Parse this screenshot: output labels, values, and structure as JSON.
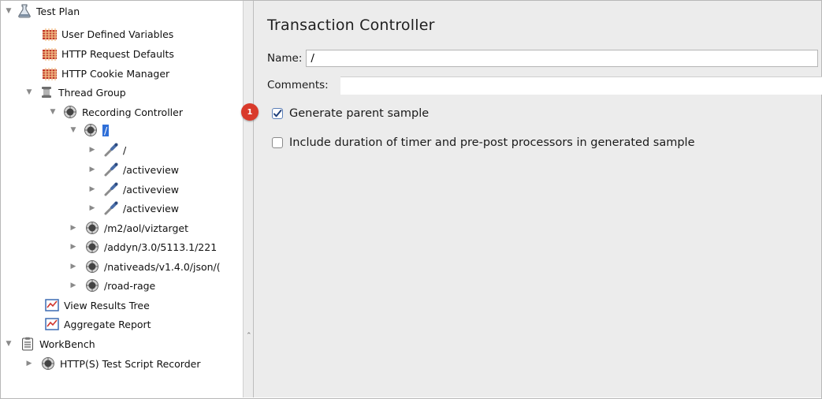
{
  "tree": {
    "items": [
      {
        "label": "Test Plan",
        "icon": "flask-icon",
        "toggle": "▼"
      },
      {
        "label": "User Defined Variables",
        "icon": "config-element-icon",
        "toggle": ""
      },
      {
        "label": "HTTP Request Defaults",
        "icon": "config-element-icon",
        "toggle": ""
      },
      {
        "label": "HTTP Cookie Manager",
        "icon": "config-element-icon",
        "toggle": ""
      },
      {
        "label": "Thread Group",
        "icon": "spool-icon",
        "toggle": "▼"
      },
      {
        "label": "Recording Controller",
        "icon": "controller-icon",
        "toggle": "▼"
      },
      {
        "label": "/",
        "icon": "controller-icon",
        "toggle": "▼"
      },
      {
        "label": "/",
        "icon": "sampler-pipette-icon",
        "toggle": "▶"
      },
      {
        "label": "/activeview",
        "icon": "sampler-pipette-icon",
        "toggle": "▶"
      },
      {
        "label": "/activeview",
        "icon": "sampler-pipette-icon",
        "toggle": "▶"
      },
      {
        "label": "/activeview",
        "icon": "sampler-pipette-icon",
        "toggle": "▶"
      },
      {
        "label": "/m2/aol/viztarget",
        "icon": "controller-icon",
        "toggle": "▶"
      },
      {
        "label": "/addyn/3.0/5113.1/221",
        "icon": "controller-icon",
        "toggle": "▶"
      },
      {
        "label": "/nativeads/v1.4.0/json/(",
        "icon": "controller-icon",
        "toggle": "▶"
      },
      {
        "label": "/road-rage",
        "icon": "controller-icon",
        "toggle": "▶"
      },
      {
        "label": "View Results Tree",
        "icon": "listener-graph-icon",
        "toggle": ""
      },
      {
        "label": "Aggregate Report",
        "icon": "listener-graph-icon",
        "toggle": ""
      },
      {
        "label": "WorkBench",
        "icon": "clipboard-icon",
        "toggle": "▼"
      },
      {
        "label": "HTTP(S) Test Script Recorder",
        "icon": "controller-icon",
        "toggle": "▶"
      }
    ]
  },
  "panel": {
    "title": "Transaction Controller",
    "name_label": "Name:",
    "name_value": "/",
    "comments_label": "Comments:",
    "generate_parent_label": "Generate parent sample",
    "generate_parent_checked": true,
    "include_duration_label": "Include duration of timer and pre-post processors in generated sample",
    "include_duration_checked": false,
    "badge_text": "1"
  },
  "colors": {
    "accent": "#2f6fd8",
    "badge": "#d93a2b",
    "panel_bg": "#ececec"
  }
}
